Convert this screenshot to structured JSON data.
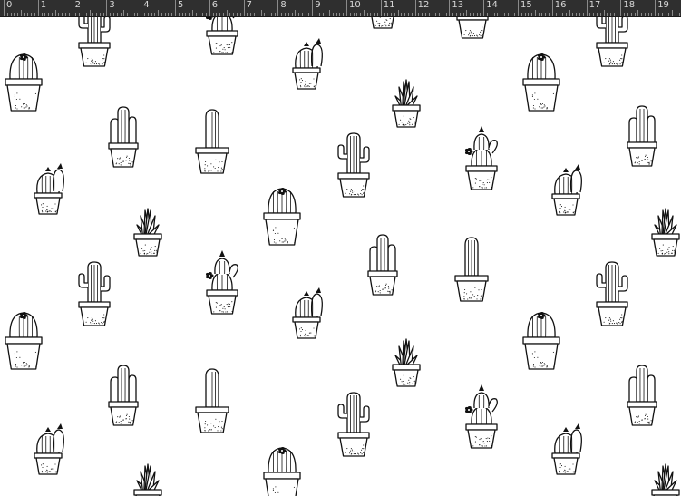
{
  "ruler": {
    "unit": "cm",
    "labels": [
      "0",
      "1",
      "2",
      "3",
      "4",
      "5",
      "6",
      "7",
      "8",
      "9",
      "10",
      "11",
      "12",
      "13",
      "14",
      "15",
      "16",
      "17",
      "18",
      "19"
    ]
  },
  "pattern": {
    "background": "#ffffff",
    "ink": "#111111",
    "motifs": [
      "saguaro-cactus",
      "barrel-cactus-with-flower",
      "cluster-cactus",
      "column-cactus",
      "round-cactus-with-flowers",
      "agave-succulent",
      "stacked-cactus-with-flowers"
    ]
  }
}
